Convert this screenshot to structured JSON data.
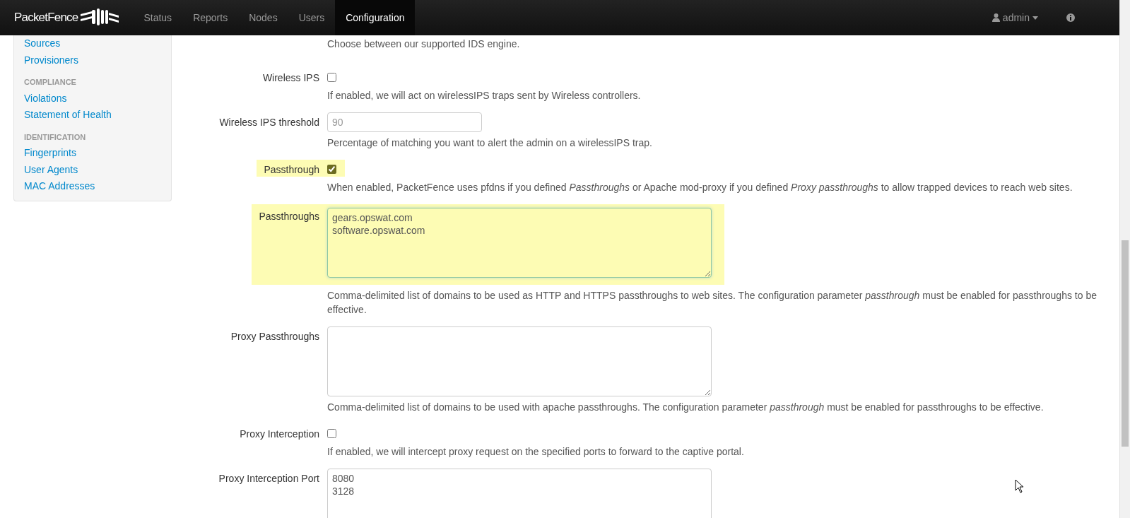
{
  "navbar": {
    "brand": "PacketFence",
    "items": [
      {
        "label": "Status",
        "selected": false
      },
      {
        "label": "Reports",
        "selected": false
      },
      {
        "label": "Nodes",
        "selected": false
      },
      {
        "label": "Users",
        "selected": false
      },
      {
        "label": "Configuration",
        "selected": true
      }
    ],
    "user": "admin"
  },
  "sidebar": {
    "groups": [
      {
        "items": [
          "Sources",
          "Provisioners"
        ]
      },
      {
        "header": "COMPLIANCE",
        "items": [
          "Violations",
          "Statement of Health"
        ]
      },
      {
        "header": "IDENTIFICATION",
        "items": [
          "Fingerprints",
          "User Agents",
          "MAC Addresses"
        ]
      }
    ]
  },
  "form": {
    "lead_help": "Choose between our supported IDS engine.",
    "rows": [
      {
        "kind": "checkbox",
        "label": "Wireless IPS",
        "checked": false,
        "highlighted": false,
        "help": "If enabled, we will act on wirelessIPS traps sent by Wireless controllers."
      },
      {
        "kind": "text",
        "label": "Wireless IPS threshold",
        "placeholder": "90",
        "highlighted": false,
        "help": "Percentage of matching you want to alert the admin on a wirelessIPS trap."
      },
      {
        "kind": "checkbox",
        "label": "Passthrough",
        "checked": true,
        "highlighted": true,
        "help": "When enabled, PacketFence uses pfdns if you defined *Passthroughs* or Apache mod-proxy if you defined *Proxy passthroughs* to allow trapped devices to reach web sites."
      },
      {
        "kind": "textarea",
        "label": "Passthroughs",
        "value": "gears.opswat.com\nsoftware.opswat.com",
        "highlighted": true,
        "help": "Comma-delimited list of domains to be used as HTTP and HTTPS passthroughs to web sites. The configuration parameter *passthrough* must be enabled for passthroughs to be effective."
      },
      {
        "kind": "textarea",
        "label": "Proxy Passthroughs",
        "highlighted": false,
        "help": "Comma-delimited list of domains to be used with apache passthroughs. The configuration parameter *passthrough* must be enabled for passthroughs to be effective."
      },
      {
        "kind": "checkbox",
        "label": "Proxy Interception",
        "checked": false,
        "highlighted": false,
        "help": "If enabled, we will intercept proxy request on the specified ports to forward to the captive portal."
      },
      {
        "kind": "textarea",
        "label": "Proxy Interception Port",
        "value": "8080\n3128",
        "highlighted": false
      }
    ]
  }
}
